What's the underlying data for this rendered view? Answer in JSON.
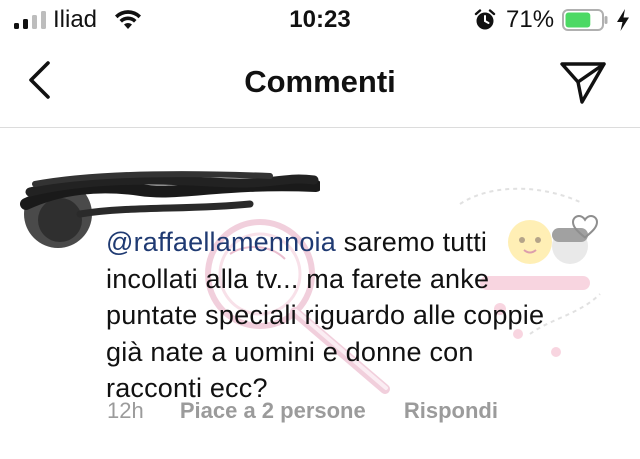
{
  "status_bar": {
    "carrier": "Iliad",
    "time": "10:23",
    "battery_percent": "71%",
    "battery_level": 0.71,
    "icons": [
      "signal-icon",
      "wifi-icon",
      "alarm-icon",
      "battery-icon",
      "charging-icon"
    ]
  },
  "nav": {
    "title": "Commenti",
    "back_icon": "chevron-left-icon",
    "send_icon": "paper-plane-icon"
  },
  "comment": {
    "mention": "@raffaellamennoia",
    "text": " saremo tutti incollati alla tv... ma farete anke puntate speciali riguardo alle coppie già nate a uomini e donne con racconti ecc?",
    "time": "12h",
    "likes": "Piace a 2 persone",
    "reply": "Rispondi",
    "heart_icon": "heart-outline-icon"
  },
  "colors": {
    "mention": "#1f3a72",
    "meta": "#9b9b9b",
    "battery_fill": "#4cd964"
  }
}
